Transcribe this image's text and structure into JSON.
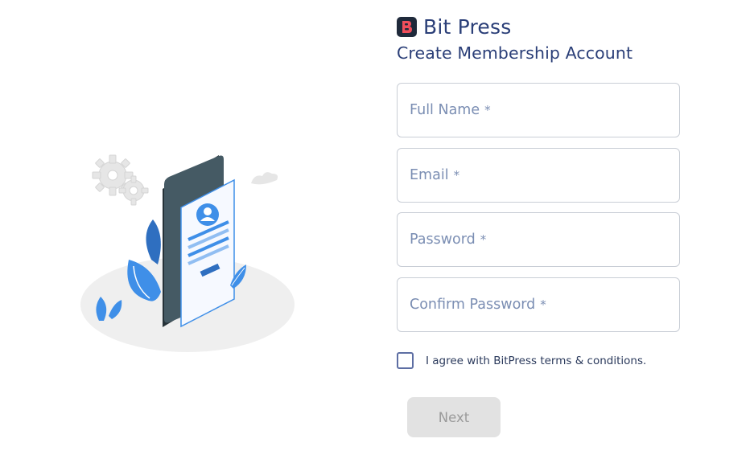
{
  "brand": {
    "name": "Bit Press",
    "logo_icon": "bitpress-logo-icon",
    "logo_color": "#1f2a3b",
    "logo_accent": "#f04e5b"
  },
  "subtitle": "Create Membership Account",
  "fields": {
    "full_name": {
      "label": "Full Name",
      "required_mark": "*"
    },
    "email": {
      "label": "Email",
      "required_mark": "*"
    },
    "password": {
      "label": "Password",
      "required_mark": "*"
    },
    "confirm_password": {
      "label": "Confirm Password",
      "required_mark": "*"
    }
  },
  "agreement": {
    "checked": false,
    "text": "I agree with BitPress terms & conditions."
  },
  "next_button": {
    "label": "Next",
    "enabled": false
  },
  "illustration": {
    "icon": "mobile-signup-illustration"
  },
  "colors": {
    "heading": "#2b3f78",
    "placeholder": "#7b8eb3",
    "accent_blue": "#3f8fe8"
  }
}
